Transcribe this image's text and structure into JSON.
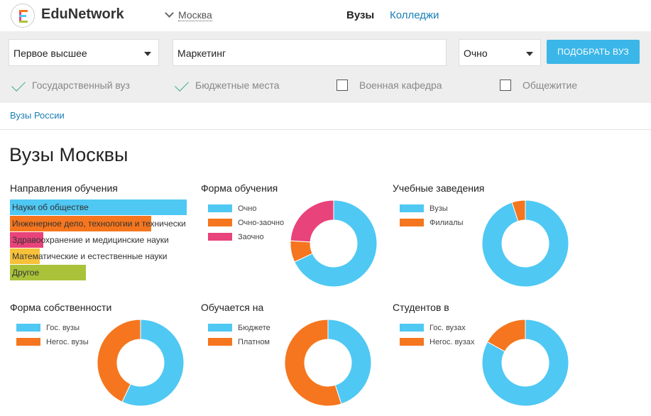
{
  "header": {
    "brand": "EduNetwork",
    "city": "Москва",
    "nav": {
      "vuzy": "Вузы",
      "colleges": "Колледжи"
    }
  },
  "filters": {
    "level": "Первое высшее",
    "specialty": "Маркетинг",
    "form": "Очно",
    "submit_label": "ПОДОБРАТЬ ВУЗ",
    "checks": [
      {
        "label": "Государственный вуз",
        "checked": true
      },
      {
        "label": "Бюджетные места",
        "checked": true
      },
      {
        "label": "Военная кафедра",
        "checked": false
      },
      {
        "label": "Общежитие",
        "checked": false
      }
    ]
  },
  "breadcrumb": "Вузы России",
  "page_title": "Вузы Москвы",
  "colors": {
    "blue": "#4fc8f3",
    "orange": "#f5761e",
    "pink": "#e8437a",
    "yellow": "#f7c13a",
    "green": "#a9c23a",
    "accent": "#3bb6e8"
  },
  "directions": {
    "title": "Направления обучения",
    "items": [
      {
        "label": "Науки об обществе",
        "share": 1.0,
        "color": "#4fc8f3"
      },
      {
        "label": "Инженерное дело, технологии и технически",
        "share": 0.8,
        "color": "#f5761e"
      },
      {
        "label": "Здравоохранение и медицинские науки",
        "share": 0.19,
        "color": "#e8437a"
      },
      {
        "label": "Математические и естественные науки",
        "share": 0.17,
        "color": "#f7c13a"
      },
      {
        "label": "Другое",
        "share": 0.43,
        "color": "#a9c23a"
      }
    ]
  },
  "chart_data": [
    {
      "type": "pie",
      "title": "Форма обучения",
      "labels": [
        "Очно",
        "Очно-заочно",
        "Заочно"
      ],
      "values": [
        68,
        8,
        24
      ],
      "colors": [
        "#4fc8f3",
        "#f5761e",
        "#e8437a"
      ]
    },
    {
      "type": "pie",
      "title": "Учебные заведения",
      "labels": [
        "Вузы",
        "Филиалы"
      ],
      "values": [
        95,
        5
      ],
      "colors": [
        "#4fc8f3",
        "#f5761e"
      ]
    },
    {
      "type": "pie",
      "title": "Форма собственности",
      "labels": [
        "Гос. вузы",
        "Негос. вузы"
      ],
      "values": [
        57,
        43
      ],
      "colors": [
        "#4fc8f3",
        "#f5761e"
      ]
    },
    {
      "type": "pie",
      "title": "Обучается на",
      "labels": [
        "Бюджете",
        "Платном"
      ],
      "values": [
        45,
        55
      ],
      "colors": [
        "#4fc8f3",
        "#f5761e"
      ]
    },
    {
      "type": "pie",
      "title": "Студентов в",
      "labels": [
        "Гос. вузах",
        "Негос. вузах"
      ],
      "values": [
        83,
        17
      ],
      "colors": [
        "#4fc8f3",
        "#f5761e"
      ]
    }
  ]
}
